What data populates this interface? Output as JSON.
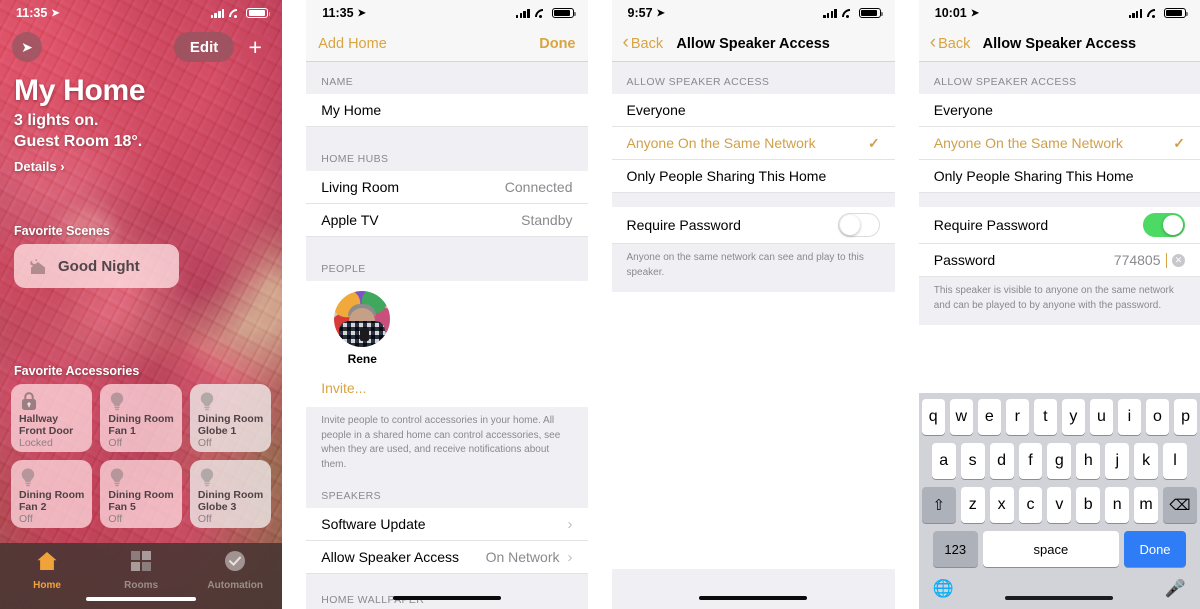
{
  "panel1": {
    "status": {
      "time": "11:35",
      "location_icon": "location-arrow-icon",
      "signal_icon": "cellular-bars-icon",
      "wifi_icon": "wifi-icon",
      "battery_icon": "battery-icon"
    },
    "location_button": "location-arrow-icon",
    "edit_label": "Edit",
    "add_label": "+",
    "title": "My Home",
    "subtitle_line1": "3 lights on.",
    "subtitle_line2": "Guest Room 18°.",
    "details_label": "Details ›",
    "scenes_header": "Favorite Scenes",
    "scene": {
      "name": "Good Night",
      "icon": "moon-house-icon"
    },
    "accessories_header": "Favorite Accessories",
    "accessories": [
      {
        "name_line1": "Hallway",
        "name_line2": "Front Door",
        "state": "Locked",
        "icon": "lock-icon",
        "dim": false
      },
      {
        "name_line1": "Dining Room",
        "name_line2": "Fan 1",
        "state": "Off",
        "icon": "bulb-icon",
        "dim": false
      },
      {
        "name_line1": "Dining Room",
        "name_line2": "Globe 1",
        "state": "Off",
        "icon": "bulb-icon",
        "dim": true
      },
      {
        "name_line1": "Dining Room",
        "name_line2": "Fan 2",
        "state": "Off",
        "icon": "bulb-icon",
        "dim": false
      },
      {
        "name_line1": "Dining Room",
        "name_line2": "Fan 5",
        "state": "Off",
        "icon": "bulb-icon",
        "dim": false
      },
      {
        "name_line1": "Dining Room",
        "name_line2": "Globe 3",
        "state": "Off",
        "icon": "bulb-icon",
        "dim": true
      }
    ],
    "tabs": [
      {
        "label": "Home",
        "icon": "house-icon",
        "active": true
      },
      {
        "label": "Rooms",
        "icon": "rooms-grid-icon",
        "active": false
      },
      {
        "label": "Automation",
        "icon": "clock-check-icon",
        "active": false
      }
    ]
  },
  "panel2": {
    "status": {
      "time": "11:35"
    },
    "nav": {
      "left_label": "Add Home",
      "right_label": "Done"
    },
    "name_header": "NAME",
    "home_name": "My Home",
    "hubs_header": "HOME HUBS",
    "hubs": [
      {
        "label": "Living Room",
        "value": "Connected"
      },
      {
        "label": "Apple TV",
        "value": "Standby"
      }
    ],
    "people_header": "PEOPLE",
    "person_name": "Rene",
    "invite_label": "Invite...",
    "people_footnote": "Invite people to control accessories in your home. All people in a shared home can control accessories, see when they are used, and receive notifications about them.",
    "speakers_header": "SPEAKERS",
    "speaker_rows": [
      {
        "label": "Software Update",
        "value": ""
      },
      {
        "label": "Allow Speaker Access",
        "value": "On Network"
      }
    ],
    "wallpaper_header": "HOME WALLPAPER"
  },
  "panel3": {
    "status": {
      "time": "9:57"
    },
    "nav": {
      "back_label": "Back",
      "title": "Allow Speaker Access"
    },
    "section_header": "ALLOW SPEAKER ACCESS",
    "options": [
      {
        "label": "Everyone",
        "selected": false
      },
      {
        "label": "Anyone On the Same Network",
        "selected": true
      },
      {
        "label": "Only People Sharing This Home",
        "selected": false
      }
    ],
    "require_password_label": "Require Password",
    "require_password_on": false,
    "footnote": "Anyone on the same network can see and play to this speaker."
  },
  "panel4": {
    "status": {
      "time": "10:01"
    },
    "nav": {
      "back_label": "Back",
      "title": "Allow Speaker Access"
    },
    "section_header": "ALLOW SPEAKER ACCESS",
    "options": [
      {
        "label": "Everyone",
        "selected": false
      },
      {
        "label": "Anyone On the Same Network",
        "selected": true
      },
      {
        "label": "Only People Sharing This Home",
        "selected": false
      }
    ],
    "require_password_label": "Require Password",
    "require_password_on": true,
    "password_label": "Password",
    "password_value": "774805",
    "footnote": "This speaker is visible to anyone on the same network and can be played to by anyone with the password.",
    "keyboard": {
      "row1": [
        "q",
        "w",
        "e",
        "r",
        "t",
        "y",
        "u",
        "i",
        "o",
        "p"
      ],
      "row2": [
        "a",
        "s",
        "d",
        "f",
        "g",
        "h",
        "j",
        "k",
        "l"
      ],
      "row3": [
        "z",
        "x",
        "c",
        "v",
        "b",
        "n",
        "m"
      ],
      "shift_icon": "shift-icon",
      "backspace_icon": "backspace-icon",
      "numbers_label": "123",
      "space_label": "space",
      "done_label": "Done",
      "globe_icon": "globe-icon",
      "mic_icon": "microphone-icon"
    }
  },
  "colors": {
    "accent_gold": "#d9a441",
    "toggle_on": "#4cd964",
    "done_blue": "#2e7df6",
    "tab_active": "#f0a33a"
  }
}
